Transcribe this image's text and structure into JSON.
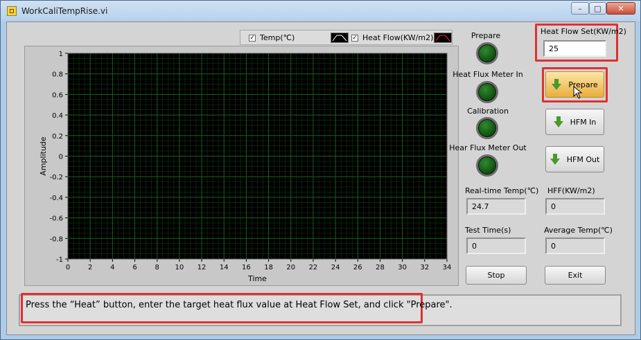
{
  "window": {
    "title": "WorkCaliTempRise.vi"
  },
  "legend": {
    "items": [
      {
        "label": "Temp(℃)",
        "checked": true,
        "color": "#ffffff"
      },
      {
        "label": "Heat Flow(KW/m2)",
        "checked": true,
        "color": "#ff3030"
      }
    ]
  },
  "chart_data": {
    "type": "line",
    "xlabel": "Time",
    "ylabel": "Amplitude",
    "xlim": [
      0,
      34
    ],
    "ylim": [
      -1,
      1
    ],
    "x_ticks": [
      "0",
      "2",
      "4",
      "6",
      "8",
      "10",
      "12",
      "14",
      "16",
      "18",
      "20",
      "22",
      "24",
      "26",
      "28",
      "30",
      "32",
      "34"
    ],
    "y_ticks": [
      "1",
      "0.8",
      "0.6",
      "0.4",
      "0.2",
      "0",
      "-0.2",
      "-0.4",
      "-0.6",
      "-0.8",
      "-1"
    ],
    "series": [
      {
        "name": "Temp(℃)",
        "values": []
      },
      {
        "name": "Heat Flow(KW/m2)",
        "values": []
      }
    ],
    "grid": true,
    "background": "#000000",
    "grid_color": "#1f5a1f"
  },
  "indicators": {
    "prepare": "Prepare",
    "hfm_in": "Heat Flux Meter In",
    "calibration": "Calibration",
    "hfm_out": "Hear Flux Meter Out"
  },
  "heat_flow_set": {
    "label": "Heat Flow Set(KW/m2)",
    "value": "25"
  },
  "buttons": {
    "prepare": "Prepare",
    "hfm_in": "HFM In",
    "hfm_out": "HFM Out",
    "stop": "Stop",
    "exit": "Exit"
  },
  "readouts": {
    "realtime_temp": {
      "label": "Real-time Temp(℃)",
      "value": "24.7"
    },
    "hff": {
      "label": "HFF(KW/m2)",
      "value": "0"
    },
    "test_time": {
      "label": "Test Time(s)",
      "value": "0"
    },
    "average_temp": {
      "label": "Average Temp(℃)",
      "value": "0"
    }
  },
  "status": {
    "message": "Press the “Heat” button, enter the target heat flux value at Heat Flow Set, and click \"Prepare\"."
  },
  "colors": {
    "highlight": "#e03030",
    "led_on": "#1f6f1f",
    "button_active": "#f0c060"
  }
}
